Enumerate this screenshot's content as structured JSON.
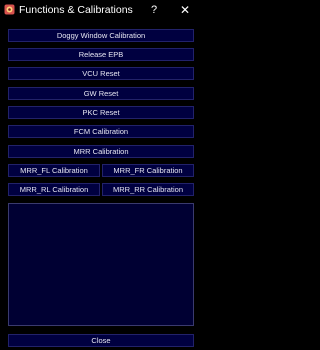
{
  "window": {
    "title": "Functions & Calibrations",
    "help_glyph": "?",
    "close_glyph": "✕"
  },
  "colors": {
    "background": "#000000",
    "button_fill": "#000040",
    "button_border": "#22226a",
    "text": "#e6e6f2"
  },
  "buttons": {
    "doggy_window_calibration": "Doggy Window Calibration",
    "release_epb": "Release EPB",
    "vcu_reset": "VCU Reset",
    "gw_reset": "GW Reset",
    "pkc_reset": "PKC Reset",
    "fcm_calibration": "FCM Calibration",
    "mrr_calibration": "MRR Calibration",
    "mrr_fl_calibration": "MRR_FL Calibration",
    "mrr_fr_calibration": "MRR_FR Calibration",
    "mrr_rl_calibration": "MRR_RL Calibration",
    "mrr_rr_calibration": "MRR_RR Calibration",
    "close": "Close"
  },
  "output": {
    "text": ""
  }
}
